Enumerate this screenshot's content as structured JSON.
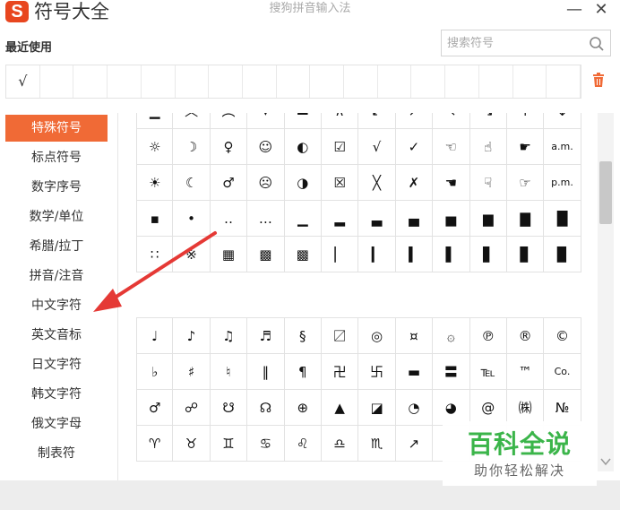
{
  "titlebar": {
    "logo_letter": "S",
    "app_title": "符号大全",
    "window_title": "搜狗拼音输入法",
    "minimize_label": "—",
    "close_label": "✕"
  },
  "recent": {
    "label": "最近使用",
    "items": [
      "√",
      "",
      "",
      "",
      "",
      "",
      "",
      "",
      "",
      "",
      "",
      "",
      "",
      "",
      "",
      "",
      ""
    ]
  },
  "search": {
    "placeholder": "搜索符号"
  },
  "categories": [
    {
      "label": "特殊符号",
      "active": true
    },
    {
      "label": "标点符号",
      "active": false
    },
    {
      "label": "数字序号",
      "active": false
    },
    {
      "label": "数学/单位",
      "active": false
    },
    {
      "label": "希腊/拉丁",
      "active": false
    },
    {
      "label": "拼音/注音",
      "active": false
    },
    {
      "label": "中文字符",
      "active": false
    },
    {
      "label": "英文音标",
      "active": false
    },
    {
      "label": "日文字符",
      "active": false
    },
    {
      "label": "韩文字符",
      "active": false
    },
    {
      "label": "俄文字母",
      "active": false
    },
    {
      "label": "制表符",
      "active": false
    }
  ],
  "grid1": [
    [
      "▁",
      "︿",
      "︵",
      "▾",
      "▬",
      "∧",
      "↙",
      "↗",
      "↖",
      "↘",
      "↑",
      "↓"
    ],
    [
      "☼",
      "☽",
      "♀",
      "☺",
      "◐",
      "☑",
      "√",
      "✓",
      "☜",
      "☝",
      "☛",
      "a.m."
    ],
    [
      "☀",
      "☾",
      "♂",
      "☹",
      "◑",
      "☒",
      "╳",
      "✗",
      "☚",
      "☟",
      "☞",
      "p.m."
    ],
    [
      "▪",
      "•",
      "‥",
      "…",
      "▁",
      "▂",
      "▃",
      "▄",
      "▅",
      "▆",
      "▇",
      "█"
    ],
    [
      "∷",
      "※",
      "▦",
      "▩",
      "▩",
      "▏",
      "▎",
      "▍",
      "▌",
      "▋",
      "▊",
      "▉"
    ]
  ],
  "grid2": [
    [
      "♩",
      "♪",
      "♫",
      "♬",
      "§",
      "〼",
      "◎",
      "¤",
      "۞",
      "℗",
      "®",
      "©"
    ],
    [
      "♭",
      "♯",
      "♮",
      "‖",
      "¶",
      "卍",
      "卐",
      "▬",
      "〓",
      "℡",
      "™",
      "Co."
    ],
    [
      "♂",
      "☍",
      "☋",
      "☊",
      "⊕",
      "▲",
      "◪",
      "◔",
      "◕",
      "@",
      "㈱",
      "№"
    ],
    [
      "♈",
      "♉",
      "♊",
      "♋",
      "♌",
      "♎",
      "♏",
      "↗",
      "",
      "",
      "",
      ""
    ]
  ],
  "watermark": {
    "main": "百科全说",
    "sub": "助你轻松解决"
  },
  "colors": {
    "accent": "#f06a36",
    "logo": "#e8461f",
    "arrow": "#e53935",
    "watermark_green": "#3bb54a"
  }
}
